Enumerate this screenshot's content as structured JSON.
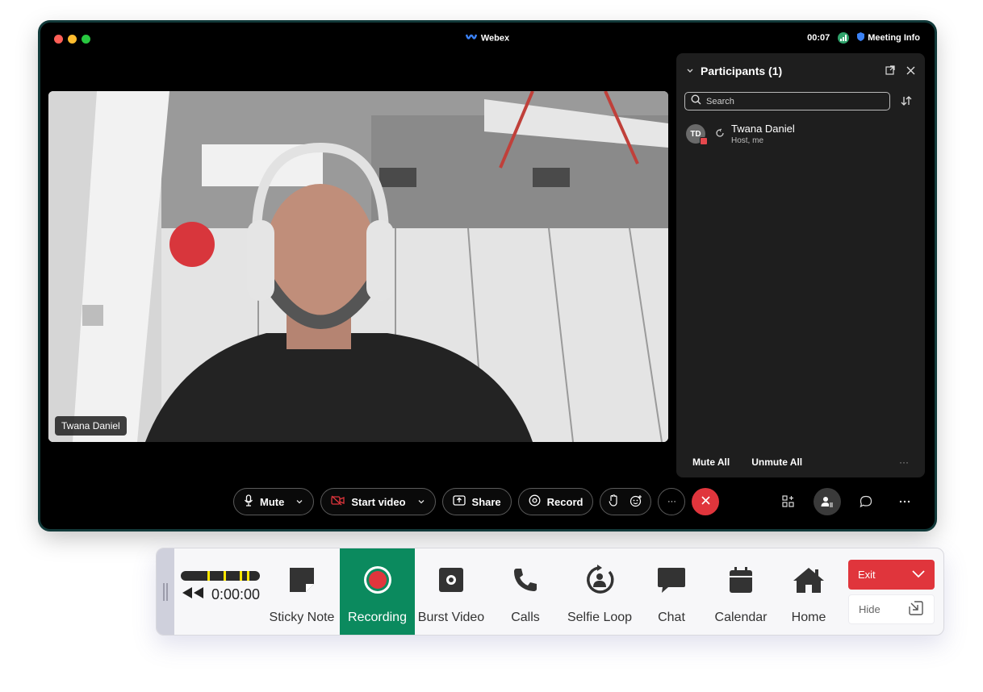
{
  "window": {
    "title": "Webex",
    "timer": "00:07",
    "meeting_info": "Meeting Info"
  },
  "video": {
    "participant_name": "Twana Daniel"
  },
  "participants_panel": {
    "title": "Participants (1)",
    "search_placeholder": "Search",
    "participants": [
      {
        "initials": "TD",
        "name": "Twana Daniel",
        "role": "Host, me"
      }
    ],
    "mute_all": "Mute All",
    "unmute_all": "Unmute All",
    "more": "···"
  },
  "controls": {
    "mute": "Mute",
    "start_video": "Start video",
    "share": "Share",
    "record": "Record",
    "more": "···"
  },
  "toolbar": {
    "progress_time": "0:00:00",
    "items": [
      {
        "label": "Sticky Note",
        "icon": "sticky-note-icon"
      },
      {
        "label": "Recording",
        "icon": "record-icon"
      },
      {
        "label": "Burst Video",
        "icon": "camera-icon"
      },
      {
        "label": "Calls",
        "icon": "phone-icon"
      },
      {
        "label": "Selfie Loop",
        "icon": "selfie-loop-icon"
      },
      {
        "label": "Chat",
        "icon": "chat-icon"
      },
      {
        "label": "Calendar",
        "icon": "calendar-icon"
      },
      {
        "label": "Home",
        "icon": "home-icon"
      }
    ],
    "exit": "Exit",
    "hide": "Hide"
  },
  "colors": {
    "recording_active": "#0b8a5e",
    "exit_red": "#e0353c",
    "end_call_red": "#e0353c",
    "timer_marker": "#ffe600"
  }
}
